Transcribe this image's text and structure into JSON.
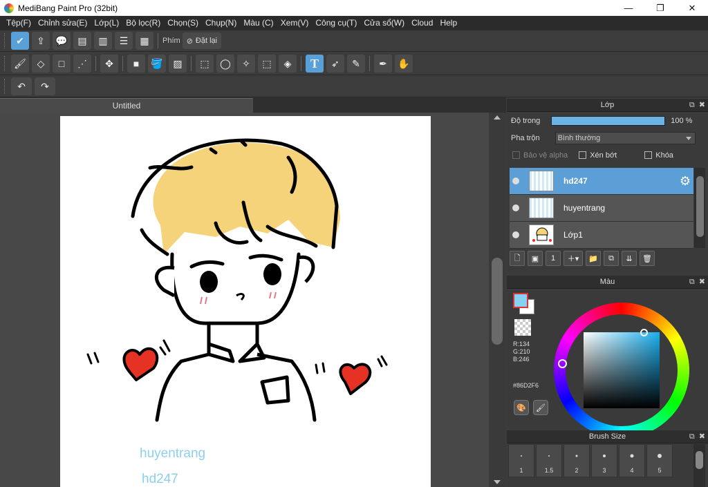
{
  "window": {
    "title": "MediBang Paint Pro (32bit)",
    "controls": [
      "—",
      "❐",
      "✕"
    ]
  },
  "menu": [
    "Tệp(F)",
    "Chỉnh sửa(E)",
    "Lớp(L)",
    "Bộ lọc(R)",
    "Chọn(S)",
    "Chụp(N)",
    "Màu (C)",
    "Xem(V)",
    "Công cụ(T)",
    "Cửa sổ(W)",
    "Cloud",
    "Help"
  ],
  "toolbar1": {
    "phim_label": "Phím",
    "reset_label": "Đặt lại"
  },
  "document": {
    "tab_title": "Untitled",
    "canvas_texts": [
      "huyentrang",
      "hd247"
    ]
  },
  "layer_panel": {
    "title": "Lớp",
    "opacity_label": "Độ trong",
    "opacity_value": "100 %",
    "opacity_fraction": 1.0,
    "blend_label": "Pha trộn",
    "blend_value": "Bình thường",
    "protect_alpha": "Bảo vệ alpha",
    "clipping": "Xén bớt",
    "lock": "Khóa",
    "layers": [
      {
        "name": "hd247",
        "selected": true
      },
      {
        "name": "huyentrang",
        "selected": false
      },
      {
        "name": "Lớp1",
        "selected": false
      }
    ]
  },
  "color_panel": {
    "title": "Màu",
    "r": "R:134",
    "g": "G:210",
    "b": "B:246",
    "hex": "#86D2F6",
    "foreground": "#86D2F6"
  },
  "brush_panel": {
    "title": "Brush Size",
    "sizes": [
      "1",
      "1.5",
      "2",
      "3",
      "4",
      "5"
    ]
  }
}
